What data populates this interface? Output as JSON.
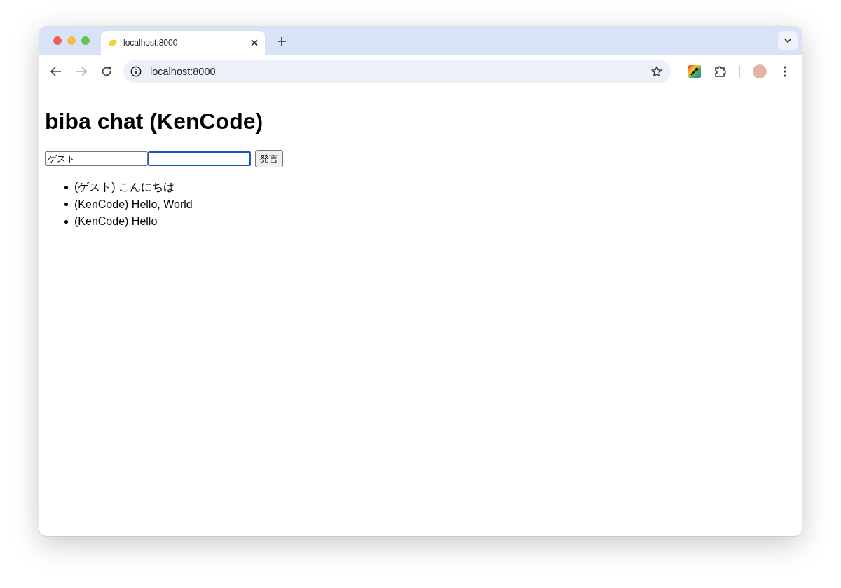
{
  "browser": {
    "tabs": [
      {
        "title": "localhost:8000",
        "selected": true
      }
    ],
    "address": "localhost:8000",
    "forward_disabled": true
  },
  "page": {
    "heading": "biba chat (KenCode)",
    "form": {
      "name_field": {
        "value": "ゲスト",
        "focused": false
      },
      "message_field": {
        "focused": true
      },
      "button": "発言"
    },
    "messages": [
      {
        "text": "(ゲスト) こんにちは"
      },
      {
        "text": "(KenCode) Hello, World"
      },
      {
        "text": "(KenCode) Hello"
      }
    ]
  }
}
